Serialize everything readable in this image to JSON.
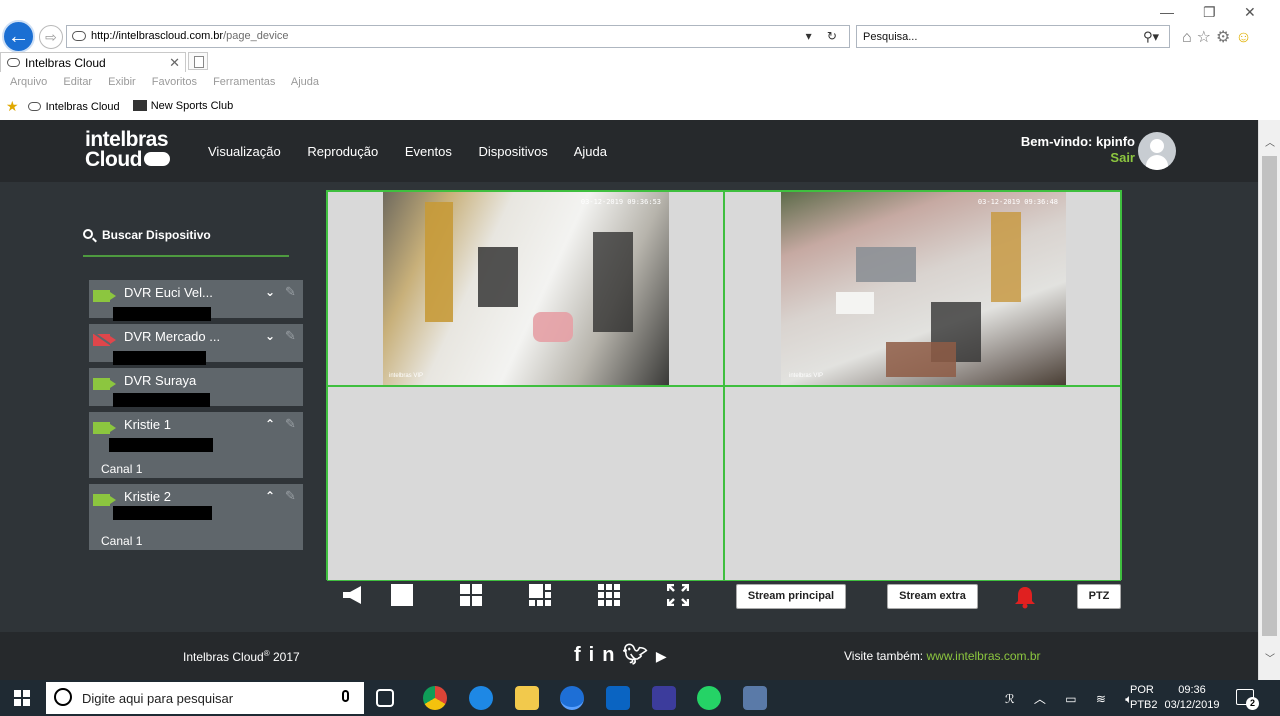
{
  "browser": {
    "url_host": "http://intelbrascloud.com.br",
    "url_path": "/page_device",
    "search_placeholder": "Pesquisa...",
    "tab_title": "Intelbras Cloud",
    "menu": [
      "Arquivo",
      "Editar",
      "Exibir",
      "Favoritos",
      "Ferramentas",
      "Ajuda"
    ],
    "favorites": [
      "Intelbras Cloud",
      "New Sports Club"
    ]
  },
  "app": {
    "logo_line1": "intelbras",
    "logo_line2": "Cloud",
    "nav": [
      "Visualização",
      "Reprodução",
      "Eventos",
      "Dispositivos",
      "Ajuda"
    ],
    "welcome": "Bem-vindo: kpinfo",
    "logout": "Sair",
    "search_label": "Buscar Dispositivo",
    "devices": [
      {
        "name": "DVR Euci Vel...",
        "status": "online",
        "chevron": "down"
      },
      {
        "name": "DVR Mercado ...",
        "status": "offline",
        "chevron": "down"
      },
      {
        "name": "DVR Suraya",
        "status": "online",
        "chevron": ""
      },
      {
        "name": "Kristie 1",
        "status": "online",
        "chevron": "up",
        "channel": "Canal 1"
      },
      {
        "name": "Kristie 2",
        "status": "online",
        "chevron": "up",
        "channel": "Canal 1"
      }
    ],
    "feeds": [
      {
        "timestamp": "03-12-2019 09:36:53",
        "watermark": "intelbras VIP"
      },
      {
        "timestamp": "03-12-2019 09:36:48",
        "watermark": "intelbras VIP"
      }
    ],
    "controls": {
      "stream_main": "Stream principal",
      "stream_extra": "Stream extra",
      "ptz": "PTZ"
    },
    "footer": {
      "copyright": "Intelbras Cloud",
      "copyright_sup": "®",
      "copyright_year": "2017",
      "visit": "Visite também:",
      "visit_link": "www.intelbras.com.br"
    }
  },
  "taskbar": {
    "search_placeholder": "Digite aqui para pesquisar",
    "lang1": "POR",
    "lang2": "PTB2",
    "time": "09:36",
    "date": "03/12/2019",
    "notifications": "2"
  }
}
